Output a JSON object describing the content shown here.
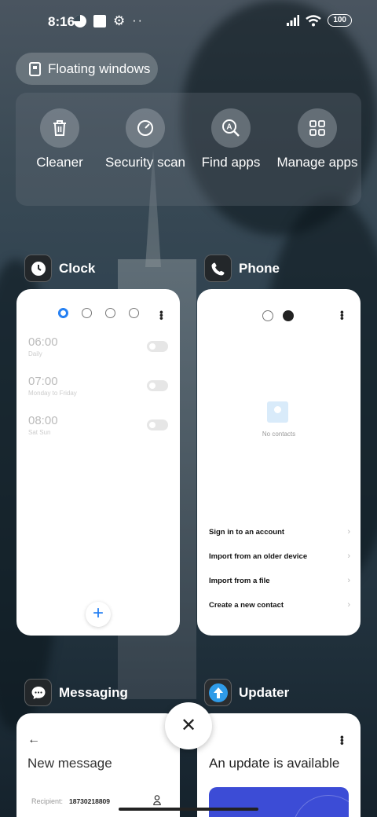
{
  "status_bar": {
    "time": "8:16",
    "battery": "100",
    "icons_left": [
      "app-notification-icon",
      "square-notification-icon",
      "gear-icon",
      "more-dots-icon"
    ],
    "icons_right": [
      "signal-icon",
      "wifi-icon",
      "battery-icon"
    ]
  },
  "floating_windows": {
    "label": "Floating windows"
  },
  "quick_actions": [
    {
      "label": "Cleaner",
      "icon": "trash-icon"
    },
    {
      "label": "Security scan",
      "icon": "security-scan-icon"
    },
    {
      "label": "Find apps",
      "icon": "find-apps-icon"
    },
    {
      "label": "Manage apps",
      "icon": "grid-icon"
    }
  ],
  "recent_apps": {
    "clock": {
      "name": "Clock",
      "alarms": [
        {
          "time": "06:00",
          "repeat": "Daily"
        },
        {
          "time": "07:00",
          "repeat": "Monday to Friday"
        },
        {
          "time": "08:00",
          "repeat": "Sat Sun"
        }
      ],
      "add_label": "+"
    },
    "phone": {
      "name": "Phone",
      "empty_text": "No contacts",
      "actions": [
        "Sign in to an account",
        "Import from an older device",
        "Import from a file",
        "Create a new contact"
      ]
    },
    "messaging": {
      "name": "Messaging",
      "title": "New message",
      "recipient_label": "Recipient:",
      "recipient_number": "18730218809"
    },
    "updater": {
      "name": "Updater",
      "title": "An update is available"
    }
  },
  "close_label": "✕"
}
